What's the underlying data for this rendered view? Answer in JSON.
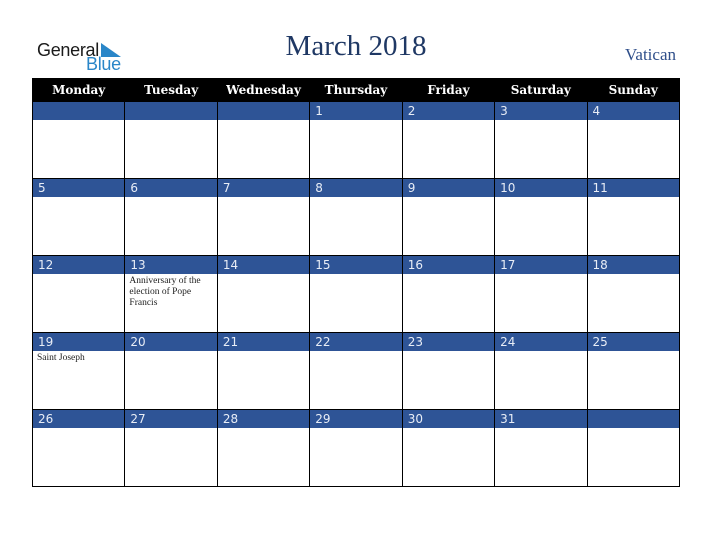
{
  "logo": {
    "word1": "General",
    "word2": "Blue",
    "icon": "triangle-flag-icon"
  },
  "header": {
    "title": "March 2018",
    "country": "Vatican"
  },
  "colors": {
    "band": "#2e5496",
    "header_bg": "#000000",
    "title": "#1f3864",
    "logo_blue": "#2a86c8"
  },
  "weekdays": [
    "Monday",
    "Tuesday",
    "Wednesday",
    "Thursday",
    "Friday",
    "Saturday",
    "Sunday"
  ],
  "weeks": [
    [
      {
        "day": "",
        "event": ""
      },
      {
        "day": "",
        "event": ""
      },
      {
        "day": "",
        "event": ""
      },
      {
        "day": "1",
        "event": ""
      },
      {
        "day": "2",
        "event": ""
      },
      {
        "day": "3",
        "event": ""
      },
      {
        "day": "4",
        "event": ""
      }
    ],
    [
      {
        "day": "5",
        "event": ""
      },
      {
        "day": "6",
        "event": ""
      },
      {
        "day": "7",
        "event": ""
      },
      {
        "day": "8",
        "event": ""
      },
      {
        "day": "9",
        "event": ""
      },
      {
        "day": "10",
        "event": ""
      },
      {
        "day": "11",
        "event": ""
      }
    ],
    [
      {
        "day": "12",
        "event": ""
      },
      {
        "day": "13",
        "event": "Anniversary of the election of Pope Francis"
      },
      {
        "day": "14",
        "event": ""
      },
      {
        "day": "15",
        "event": ""
      },
      {
        "day": "16",
        "event": ""
      },
      {
        "day": "17",
        "event": ""
      },
      {
        "day": "18",
        "event": ""
      }
    ],
    [
      {
        "day": "19",
        "event": "Saint Joseph"
      },
      {
        "day": "20",
        "event": ""
      },
      {
        "day": "21",
        "event": ""
      },
      {
        "day": "22",
        "event": ""
      },
      {
        "day": "23",
        "event": ""
      },
      {
        "day": "24",
        "event": ""
      },
      {
        "day": "25",
        "event": ""
      }
    ],
    [
      {
        "day": "26",
        "event": ""
      },
      {
        "day": "27",
        "event": ""
      },
      {
        "day": "28",
        "event": ""
      },
      {
        "day": "29",
        "event": ""
      },
      {
        "day": "30",
        "event": ""
      },
      {
        "day": "31",
        "event": ""
      },
      {
        "day": "",
        "event": ""
      }
    ]
  ]
}
